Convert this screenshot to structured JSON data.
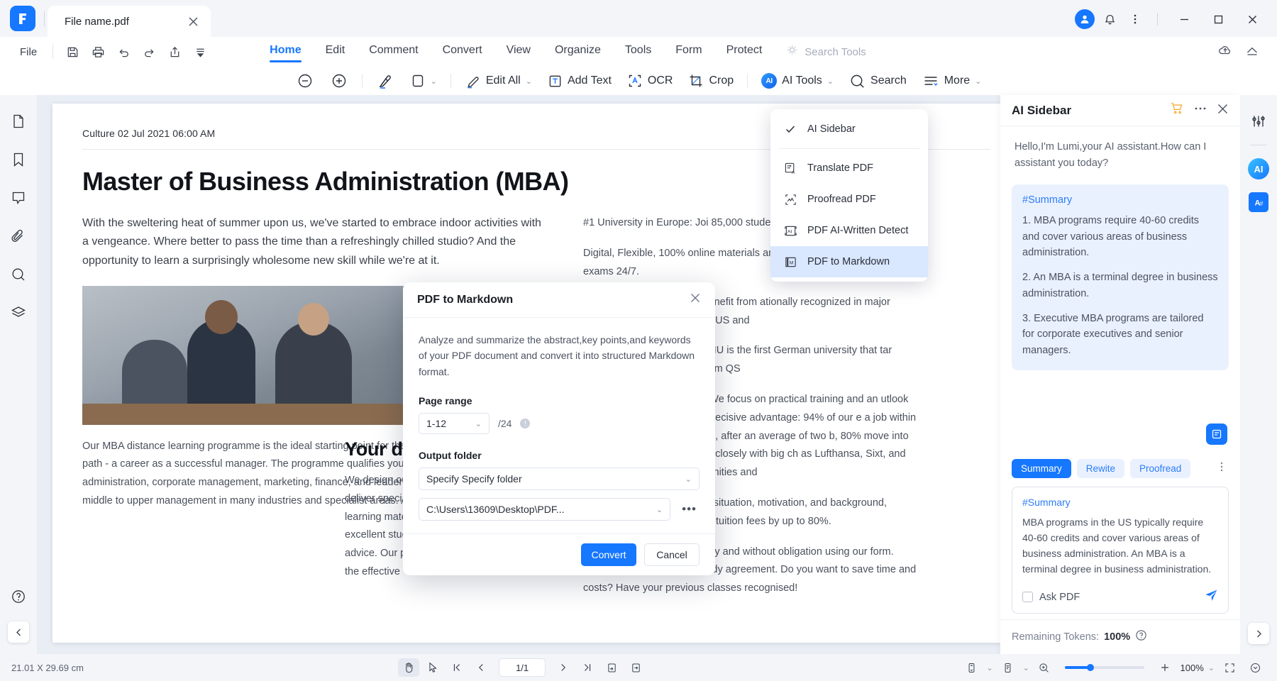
{
  "window": {
    "app_logo": "pdfelement-logo",
    "tab_title": "File name.pdf",
    "close_tab_icon": "close-icon",
    "account_icon": "user-avatar-icon",
    "notification_icon": "bell-icon",
    "overflow_icon": "more-vertical-icon",
    "minimize_icon": "minimize-icon",
    "maximize_icon": "maximize-icon",
    "close_icon": "close-icon"
  },
  "ribbon": {
    "file_label": "File",
    "quick_actions": [
      {
        "name": "save-icon",
        "label": "Save"
      },
      {
        "name": "print-icon",
        "label": "Print"
      },
      {
        "name": "undo-icon",
        "label": "Undo"
      },
      {
        "name": "redo-icon",
        "label": "Redo"
      },
      {
        "name": "share-icon",
        "label": "Share"
      },
      {
        "name": "customize-caret-icon",
        "label": "Customize"
      }
    ],
    "menus": [
      {
        "label": "Home",
        "active": true
      },
      {
        "label": "Edit",
        "active": false
      },
      {
        "label": "Comment",
        "active": false
      },
      {
        "label": "Convert",
        "active": false
      },
      {
        "label": "View",
        "active": false
      },
      {
        "label": "Organize",
        "active": false
      },
      {
        "label": "Tools",
        "active": false
      },
      {
        "label": "Form",
        "active": false
      },
      {
        "label": "Protect",
        "active": false
      }
    ],
    "search_tools_placeholder": "Search Tools",
    "bulb_icon": "lightbulb-icon",
    "cloud_icon": "cloud-upload-icon",
    "collapse_icon": "collapse-ribbon-icon",
    "tools": [
      {
        "label": "",
        "icon": "zoom-out-icon"
      },
      {
        "label": "",
        "icon": "zoom-in-icon"
      },
      {
        "label": "",
        "icon": "highlighter-icon"
      },
      {
        "label": "",
        "icon": "shape-rect-icon",
        "caret": true
      },
      {
        "label": "Edit All",
        "icon": "edit-pencil-icon",
        "caret": true
      },
      {
        "label": "Add Text",
        "icon": "add-text-icon"
      },
      {
        "label": "OCR",
        "icon": "ocr-icon"
      },
      {
        "label": "Crop",
        "icon": "crop-icon"
      },
      {
        "label": "AI Tools",
        "icon": "ai-badge-icon",
        "caret": true
      },
      {
        "label": "Search",
        "icon": "search-icon"
      },
      {
        "label": "More",
        "icon": "more-lines-icon",
        "caret": true
      }
    ]
  },
  "left_rail": {
    "items": [
      {
        "name": "thumbnails-icon",
        "label": "Page Thumbnails"
      },
      {
        "name": "bookmark-icon",
        "label": "Bookmarks"
      },
      {
        "name": "comment-icon",
        "label": "Comments"
      },
      {
        "name": "attachment-icon",
        "label": "Attachments"
      },
      {
        "name": "search-icon",
        "label": "Search"
      },
      {
        "name": "layers-icon",
        "label": "Layers"
      }
    ],
    "help_icon": "help-circle-icon",
    "collapse_icon": "chevron-left-icon"
  },
  "right_rail": {
    "settings_icon": "sliders-icon",
    "ai_badge_label": "AI",
    "translate_label": "A",
    "translate_icon": "translate-a-hash-icon",
    "expand_icon": "chevron-right-icon"
  },
  "dropdown": {
    "items": [
      {
        "label": "AI Sidebar",
        "icon": "check-icon",
        "selected": false,
        "checked": true
      },
      {
        "label": "Translate PDF",
        "icon": "translate-pdf-icon",
        "selected": false,
        "checked": false
      },
      {
        "label": "Proofread PDF",
        "icon": "proofread-pdf-icon",
        "selected": false,
        "checked": false
      },
      {
        "label": "PDF AI-Written Detect",
        "icon": "ai-detect-icon",
        "selected": false,
        "checked": false
      },
      {
        "label": "PDF to Markdown",
        "icon": "pdf-markdown-icon",
        "selected": true,
        "checked": false
      }
    ]
  },
  "modal": {
    "title": "PDF to Markdown",
    "close_icon": "close-icon",
    "description": "Analyze and summarize the abstract,key points,and keywords of your PDF document and convert it into structured Markdown format.",
    "page_range_label": "Page range",
    "page_range_value": "1-12",
    "page_total": "/24",
    "info_icon": "info-icon",
    "output_folder_label": "Output folder",
    "output_folder_value": "Specify Specify folder",
    "output_path_value": "C:\\Users\\13609\\Desktop\\PDF...",
    "browse_icon": "more-horizontal-icon",
    "convert_label": "Convert",
    "cancel_label": "Cancel"
  },
  "ai_sidebar": {
    "title": "AI Sidebar",
    "cart_icon": "shopping-cart-icon",
    "more_icon": "more-horizontal-icon",
    "close_icon": "close-icon",
    "greeting": "Hello,I'm Lumi,your AI assistant.How can I assistant you today?",
    "summary_card": {
      "title": "#Summary",
      "items": [
        "1. MBA programs require 40-60 credits and cover various areas of business administration.",
        "2. An MBA is a terminal degree in business administration.",
        "3. Executive MBA programs are tailored for corporate executives and senior managers."
      ]
    },
    "float_icon": "note-icon",
    "chips": [
      {
        "label": "Summary",
        "active": true
      },
      {
        "label": "Rewite",
        "active": false
      },
      {
        "label": "Proofread",
        "active": false
      }
    ],
    "chips_more_icon": "more-vertical-icon",
    "compose": {
      "title": "#Summary",
      "text": "MBA programs in the US typically require 40-60 credits and cover various areas of business administration. An MBA is a terminal degree in business administration.",
      "checkbox_label": "Ask PDF",
      "send_icon": "send-icon"
    },
    "tokens_label": "Remaining Tokens:",
    "tokens_value": "100%",
    "tokens_help_icon": "help-circle-icon"
  },
  "document": {
    "meta": "Culture 02 Jul 2021 06:00 AM",
    "heading": "Master of Business Administration (MBA)",
    "left_paragraph": "With the sweltering heat of summer upon us, we've started to embrace indoor activities with a vengeance. Where better to pass the time than a refreshingly chilled studio? And the opportunity to learn a surprisingly wholesome new skill while we're at it.",
    "image_alt": "business-people-photo",
    "left_paragraph_2": "Our MBA distance learning programme is the ideal starting point for the next step in your professional path - a career as a successful manager. The programme qualifies you in the areas of business administration, corporate management, marketing, finance, and leadership for demanding activities in middle to upper management in many industries and specialist areas. And its international orientation",
    "subheading": "Your de",
    "mid_paragraph": "We design our p flexible and inn quality. We deliver specialist expertise and innovative learning materials as well as focusing on excellent student services and professional advice. Our programmes are characterised by the effective",
    "right_paragraphs": [
      "#1 University in Europe: Joi 85,000 students",
      "Digital, Flexible, 100% online materials and a great online are with online exams 24/7.",
      "d Degree: All our degrees benefit from ationally recognized in major jurisdictions such as the EU, US and",
      "ar rated University from QS: IU is the first German university that tar rating for Online Learning from QS",
      "ocus, Practical Orientation: We focus on practical training and an utlook which gives IU graduates a decisive advantage: 94% of our e a job within six months of graduation and, after an average of two b, 80% move into management. Plus, we work closely with big ch as Lufthansa, Sixt, and EY to give you great opportunities and",
      "vailable: Depending on your situation, motivation, and background, arships that can reduce your tuition fees by up to 80%.",
      "Secure your place at IU easily and without obligation using our form. We'll then send you your study agreement. Do you want to save time and costs? Have your previous classes recognised!"
    ]
  },
  "statusbar": {
    "dimensions": "21.01 X 29.69 cm",
    "hand_icon": "hand-tool-icon",
    "select_icon": "select-tool-icon",
    "first_page_icon": "first-page-icon",
    "prev_page_icon": "prev-page-icon",
    "page_indicator": "1/1",
    "next_page_icon": "next-page-icon",
    "last_page_icon": "last-page-icon",
    "fit_page_icon": "fit-page-icon",
    "fit_width_icon": "fit-width-icon",
    "scroll_mode_icon": "scroll-mode-icon",
    "layout_mode_icon": "layout-mode-icon",
    "zoom_out_icon": "zoom-out-icon",
    "zoom_in_icon": "zoom-in-plus-icon",
    "zoom_value": "100%",
    "zoom_caret_icon": "chevron-down-icon",
    "fullscreen_icon": "fullscreen-icon",
    "more_view_icon": "more-view-icon"
  }
}
